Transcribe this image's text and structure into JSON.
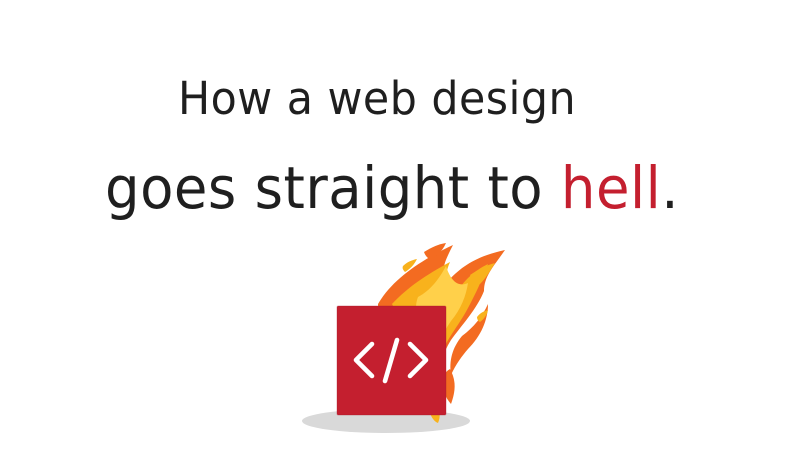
{
  "headline": {
    "line_1": "How a web design",
    "line_2_prefix": "goes straight to ",
    "line_2_highlight": "hell",
    "line_2_suffix": "."
  },
  "illustration": {
    "icon_name": "code-tag-icon",
    "glyph": "</>",
    "colors": {
      "box": "#c41f2f",
      "text_dark": "#1f1f1f",
      "accent": "#c41f2f",
      "flame_orange": "#f36b21",
      "flame_yellow": "#f8b21c",
      "shadow": "#d9d9d9"
    }
  }
}
